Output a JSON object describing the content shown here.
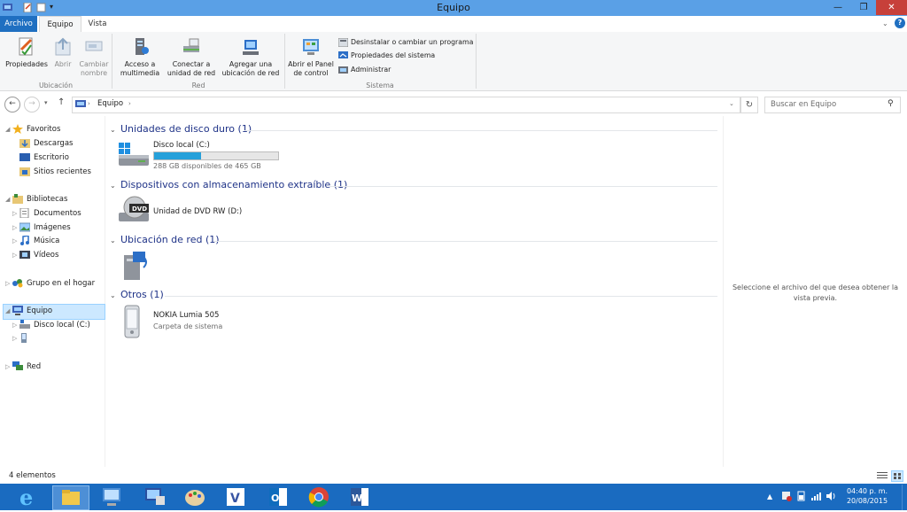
{
  "window": {
    "title": "Equipo"
  },
  "tabs": {
    "archivo": "Archivo",
    "equipo": "Equipo",
    "vista": "Vista"
  },
  "ribbon": {
    "ubicacion": {
      "label": "Ubicación",
      "propiedades": "Propiedades",
      "abrir": "Abrir",
      "cambiar_nombre": "Cambiar nombre"
    },
    "red": {
      "label": "Red",
      "acceso_multimedia": "Acceso a multimedia",
      "conectar_unidad": "Conectar a unidad de red",
      "agregar_ubicacion": "Agregar una ubicación de red"
    },
    "sistema": {
      "label": "Sistema",
      "panel_control": "Abrir el Panel de control",
      "desinstalar": "Desinstalar o cambiar un programa",
      "propiedades_sistema": "Propiedades del sistema",
      "administrar": "Administrar"
    }
  },
  "address": {
    "path": "Equipo",
    "search_placeholder": "Buscar en Equipo"
  },
  "nav": {
    "favoritos": "Favoritos",
    "descargas": "Descargas",
    "escritorio": "Escritorio",
    "sitios": "Sitios recientes",
    "bibliotecas": "Bibliotecas",
    "documentos": "Documentos",
    "imagenes": "Imágenes",
    "musica": "Música",
    "videos": "Vídeos",
    "grupo_hogar": "Grupo en el hogar",
    "equipo": "Equipo",
    "disco_local": "Disco local (C:)",
    "red": "Red"
  },
  "sections": {
    "discos": "Unidades de disco duro (1)",
    "extraible": "Dispositivos con almacenamiento extraíble (1)",
    "red": "Ubicación de red (1)",
    "otros": "Otros (1)"
  },
  "items": {
    "disco": {
      "name": "Disco local (C:)",
      "free": "288 GB disponibles de 465 GB",
      "used_fraction": 0.38
    },
    "dvd": {
      "name": "Unidad de DVD RW (D:)",
      "badge": "DVD"
    },
    "nokia": {
      "name": "NOKIA Lumia 505",
      "type": "Carpeta de sistema"
    }
  },
  "preview": {
    "text": "Seleccione el archivo del que desea obtener la vista previa."
  },
  "status": {
    "count": "4 elementos"
  },
  "taskbar": {
    "time": "04:40 p. m.",
    "date": "20/08/2015"
  },
  "colors": {
    "accent": "#1f6fc1",
    "titlebar": "#5aa0e6",
    "taskbar": "#1a6bc0",
    "close": "#c7403a",
    "progress": "#26a0da"
  }
}
